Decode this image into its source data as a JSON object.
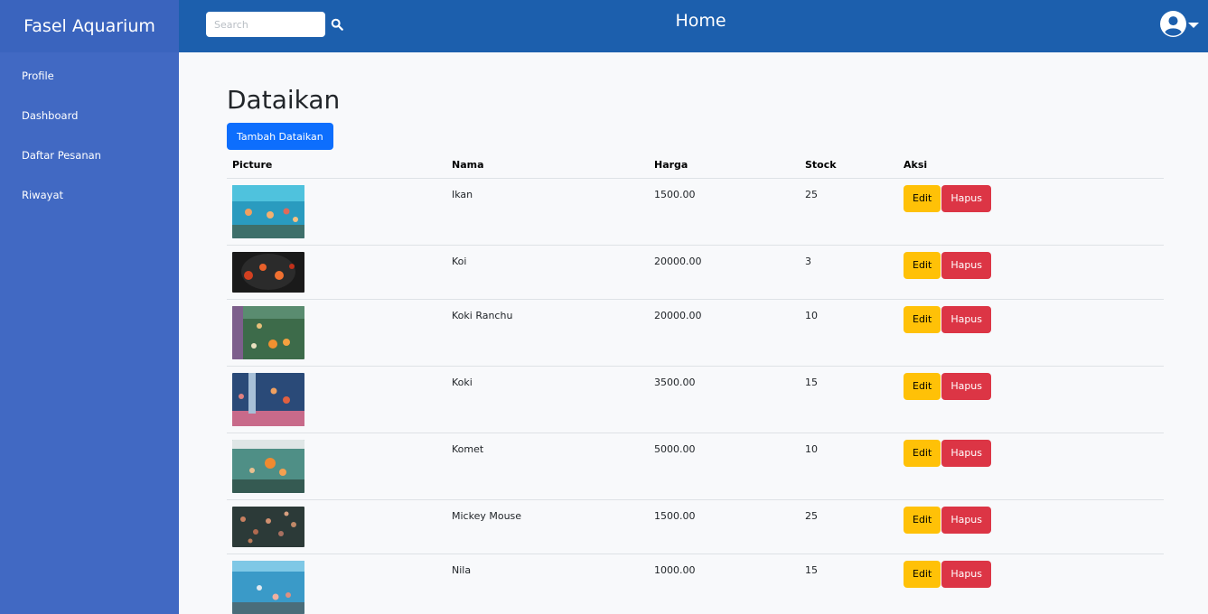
{
  "app": {
    "brand": "Fasel Aquarium"
  },
  "sidebar": {
    "items": [
      {
        "label": "Profile"
      },
      {
        "label": "Dashboard"
      },
      {
        "label": "Daftar Pesanan"
      },
      {
        "label": "Riwayat"
      }
    ]
  },
  "topbar": {
    "title": "Home",
    "search_placeholder": "Search"
  },
  "page": {
    "title": "Dataikan",
    "add_button": "Tambah Dataikan"
  },
  "table": {
    "headers": {
      "picture": "Picture",
      "nama": "Nama",
      "harga": "Harga",
      "stock": "Stock",
      "aksi": "Aksi"
    },
    "edit_label": "Edit",
    "delete_label": "Hapus",
    "rows": [
      {
        "nama": "Ikan",
        "harga": "1500.00",
        "stock": "25"
      },
      {
        "nama": "Koi",
        "harga": "20000.00",
        "stock": "3"
      },
      {
        "nama": "Koki Ranchu",
        "harga": "20000.00",
        "stock": "10"
      },
      {
        "nama": "Koki",
        "harga": "3500.00",
        "stock": "15"
      },
      {
        "nama": "Komet",
        "harga": "5000.00",
        "stock": "10"
      },
      {
        "nama": "Mickey Mouse",
        "harga": "1500.00",
        "stock": "25"
      },
      {
        "nama": "Nila",
        "harga": "1000.00",
        "stock": "15"
      }
    ]
  },
  "colors": {
    "sidebar": "#4169c3",
    "topbar": "#1c5fad",
    "primary": "#0d6efd",
    "warning": "#ffc107",
    "danger": "#dc3545"
  }
}
